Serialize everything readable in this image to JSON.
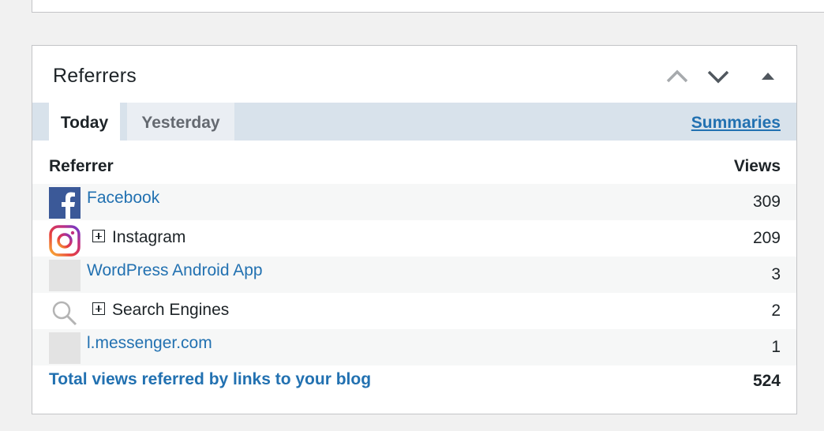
{
  "widget": {
    "title": "Referrers",
    "controls": {
      "move_up_icon": "chevron-up-icon",
      "move_down_icon": "chevron-down-icon",
      "collapse_icon": "triangle-up-icon"
    },
    "tabs": [
      {
        "label": "Today",
        "active": true
      },
      {
        "label": "Yesterday",
        "active": false
      }
    ],
    "summaries_label": "Summaries",
    "columns": {
      "referrer": "Referrer",
      "views": "Views"
    },
    "rows": [
      {
        "name": "Facebook",
        "views": "309",
        "icon": "facebook-icon",
        "is_link": true,
        "expandable": false
      },
      {
        "name": "Instagram",
        "views": "209",
        "icon": "instagram-icon",
        "is_link": false,
        "expandable": true
      },
      {
        "name": "WordPress Android App",
        "views": "3",
        "icon": "placeholder-icon",
        "is_link": true,
        "expandable": false
      },
      {
        "name": "Search Engines",
        "views": "2",
        "icon": "search-icon",
        "is_link": false,
        "expandable": true
      },
      {
        "name": "l.messenger.com",
        "views": "1",
        "icon": "placeholder-icon",
        "is_link": true,
        "expandable": false
      }
    ],
    "total": {
      "label": "Total views referred by links to your blog",
      "value": "524"
    }
  },
  "colors": {
    "link": "#2271b1",
    "tab_bar": "#d8e2eb",
    "row_alt": "#f6f7f7",
    "facebook": "#3b5998",
    "page_bg": "#f1f1f1"
  }
}
